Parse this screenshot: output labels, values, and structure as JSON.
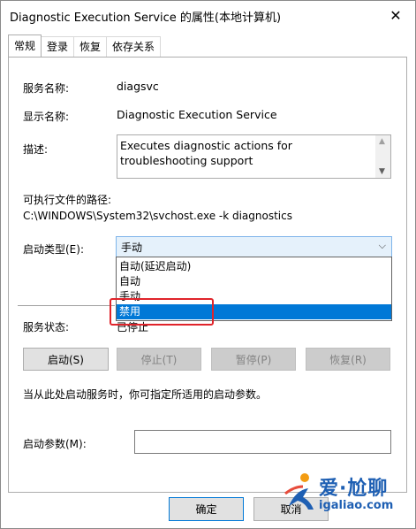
{
  "window": {
    "title": "Diagnostic Execution Service 的属性(本地计算机)",
    "close_glyph": "✕"
  },
  "tabs": [
    {
      "label": "常规",
      "active": true
    },
    {
      "label": "登录",
      "active": false
    },
    {
      "label": "恢复",
      "active": false
    },
    {
      "label": "依存关系",
      "active": false
    }
  ],
  "general": {
    "service_name_label": "服务名称:",
    "service_name": "diagsvc",
    "display_name_label": "显示名称:",
    "display_name": "Diagnostic Execution Service",
    "description_label": "描述:",
    "description": "Executes diagnostic actions for troubleshooting support",
    "path_label": "可执行文件的路径:",
    "path": "C:\\WINDOWS\\System32\\svchost.exe -k diagnostics",
    "startup_type_label": "启动类型(E):",
    "startup_type_value": "手动",
    "startup_options": [
      "自动(延迟启动)",
      "自动",
      "手动",
      "禁用"
    ],
    "startup_selected_index": 3,
    "status_label": "服务状态:",
    "status_value": "已停止",
    "buttons": {
      "start": "启动(S)",
      "stop": "停止(T)",
      "pause": "暂停(P)",
      "resume": "恢复(R)"
    },
    "hint": "当从此处启动服务时，你可指定所适用的启动参数。",
    "params_label": "启动参数(M):",
    "params_value": ""
  },
  "footer": {
    "ok": "确定",
    "cancel": "取消"
  },
  "watermark": {
    "brand": "爱·尬聊",
    "url": "igaliao.com"
  },
  "colors": {
    "selection": "#0078d7",
    "highlight_box": "#e0242b",
    "watermark": "#1e5fb3"
  }
}
